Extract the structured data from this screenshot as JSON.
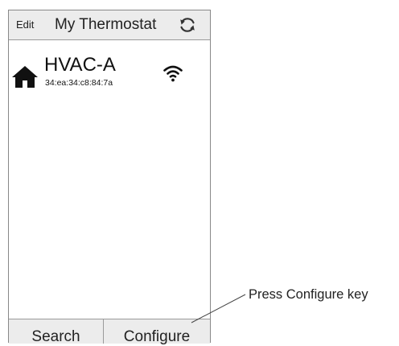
{
  "header": {
    "edit_label": "Edit",
    "title": "My Thermostat",
    "refresh_icon": "refresh-icon"
  },
  "devices": [
    {
      "name": "HVAC-A",
      "mac": "34:ea:34:c8:84:7a",
      "type_icon": "home-icon",
      "signal_icon": "wifi-icon"
    }
  ],
  "footer": {
    "search_label": "Search",
    "configure_label": "Configure"
  },
  "callout": {
    "text": "Press Configure key"
  },
  "colors": {
    "header_bg": "#ececec",
    "border": "#9a9a9a",
    "text": "#222222"
  }
}
